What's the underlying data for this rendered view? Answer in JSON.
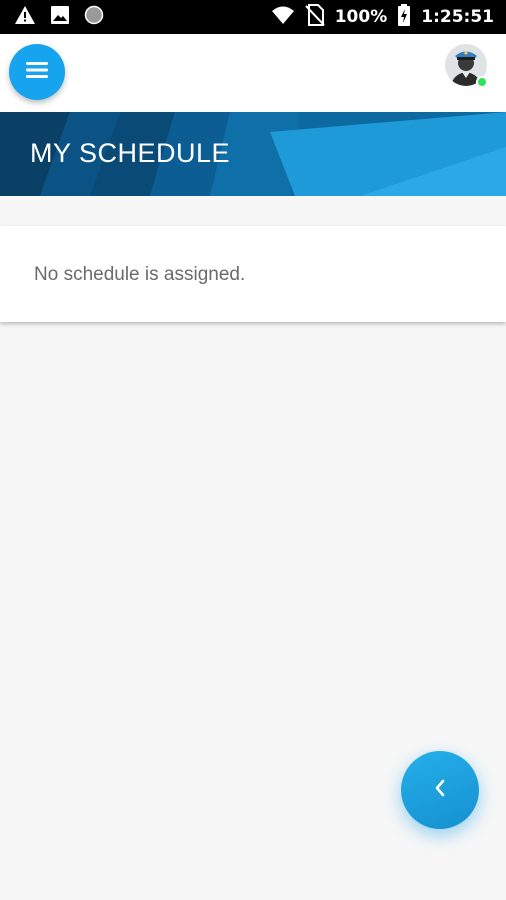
{
  "status_bar": {
    "battery_percent": "100%",
    "time": "1:25:51",
    "icons": [
      "warning-icon",
      "image-icon",
      "circle-icon",
      "wifi-icon",
      "no-sim-icon",
      "battery-charging-icon"
    ]
  },
  "header": {
    "menu_icon": "hamburger-menu-icon",
    "avatar_icon": "officer-avatar-icon",
    "online_status_color": "#2ee25a"
  },
  "banner": {
    "title": "MY SCHEDULE"
  },
  "schedule": {
    "empty_message": "No schedule is assigned."
  },
  "fab": {
    "icon": "chevron-left-icon"
  },
  "colors": {
    "accent": "#16a4ee",
    "banner_dark": "#0a5c8e",
    "banner_light": "#1ea6e6"
  }
}
